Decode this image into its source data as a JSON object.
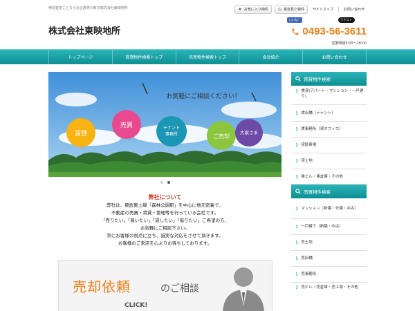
{
  "header": {
    "tagline": "売却査定ことなら北企郡男川町の株式会社東映地所",
    "favorites_label": "お気に入り物件",
    "recent_label": "最近見た物件",
    "sitemap_label": "サイトマップ",
    "contact_link_label": "お問い合わせ",
    "logo": "株式会社東映地所",
    "fb_label": "いいね！",
    "x_label": "X ポスト",
    "phone": "0493-56-3611",
    "hours": "営業時間9:00～18:00"
  },
  "nav": {
    "items": [
      "トップページ",
      "賃貸物件検索トップ",
      "売買物件検索トップ",
      "会社紹介",
      "お問い合わせ"
    ]
  },
  "hero": {
    "headline": "お気軽にご相談ください！",
    "bubbles": [
      "賃貸",
      "売買",
      "テナント\n事務所",
      "ご売却",
      "大家さま"
    ]
  },
  "about": {
    "title": "弊社について",
    "lines": [
      "弊社は、東武東上線「森林公園駅」を中心に地元密着で、",
      "不動産の売買・賃貸・管理等を行っている会社です。",
      "「売りたい」「買いたい」「貸したい」「借りたい」ご希望の方、",
      "お気軽にご相談下さい。",
      "常にお客様の視点に立ち、誠実な対応をさせて頂きます。",
      "お客様のご来店を心よりお待ちしております。"
    ]
  },
  "banner": {
    "main": "売却依頼",
    "sub": "のご相談",
    "click": "CLICK!"
  },
  "sidebar": {
    "rent_title": "賃貸物件検索",
    "rent_items": [
      "賃貸(アパート・マンション・一戸建て)",
      "賃店舗（テナント）",
      "賃事務所（貸オフィス）",
      "貸駐車場",
      "貸土地",
      "賃ビル・賃倉庫・その他"
    ],
    "sale_title": "売買物件検索",
    "sale_items": [
      "マンション（新築・分譲・中古）",
      "一戸建て（新築・中古）",
      "売土地",
      "売店舗",
      "売事務所",
      "売ビル・売倉庫・売工場・その他"
    ]
  },
  "colors": {
    "accent": "#0d8f93",
    "phone": "#f07f16",
    "about_title": "#d9361f"
  }
}
